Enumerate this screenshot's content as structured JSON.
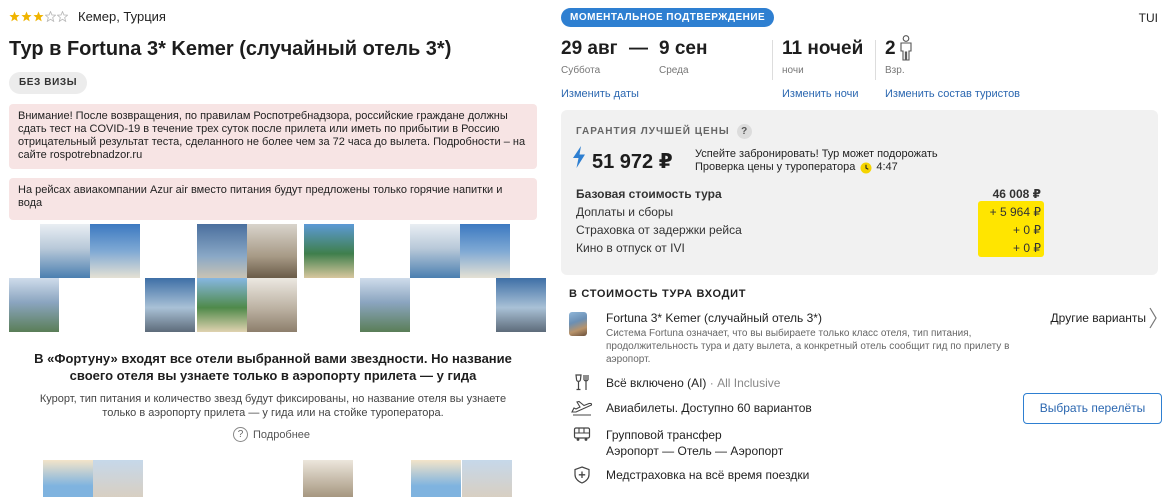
{
  "hotel": {
    "stars_filled": 3,
    "stars_total": 5,
    "location": "Кемер, Турция",
    "title_prefix": "Тур в ",
    "title_name": "Fortuna 3* Kemer (случайный отель 3*)",
    "visa_badge": "БЕЗ ВИЗЫ"
  },
  "warnings": [
    "Внимание! После возвращения, по правилам Роспотребнадзора, российские граждане должны сдать тест на COVID-19 в течение трех суток после прилета или иметь по прибытии в Россию отрицательный результат теста, сделанного не более чем за 72 часа до вылета. Подробности – на сайте rospotrebnadzor.ru",
    "На рейсах авиакомпании Azur air вместо питания будут предложены только горячие напитки и вода"
  ],
  "fortuna": {
    "heading": "В «Фортуну» входят все отели выбранной вами звездности. Но название своего отеля вы узнаете только в аэропорту прилета — у гида",
    "subtext": "Курорт, тип питания и количество звезд будут фиксированы, но название отеля вы узнаете только в аэропорту прилета — у гида или на стойке туроператора.",
    "more_link": "Подробнее"
  },
  "booking": {
    "instant_badge": "МОМЕНТАЛЬНОЕ ПОДТВЕРЖДЕНИЕ",
    "operator": "TUI",
    "date_from": "29 авг",
    "dash": "—",
    "date_to": "9 сен",
    "day_from": "Суббота",
    "day_to": "Среда",
    "nights": "11 ночей",
    "nights_sub": "ночи",
    "adults": "2",
    "adults_sub": "Взр.",
    "change_dates": "Изменить даты",
    "change_nights": "Изменить ночи",
    "change_tourists": "Изменить состав туристов"
  },
  "price": {
    "guarantee": "ГАРАНТИЯ ЛУЧШЕЙ ЦЕНЫ",
    "help": "?",
    "total": "51 972 ₽",
    "hurry_line1": "Успейте забронировать! Тур может подорожать",
    "hurry_line2": "Проверка цены у туроператора",
    "timer": "4:47",
    "base_label": "Базовая стоимость тура",
    "base_value": "46 008 ₽",
    "lines": [
      {
        "label": "Доплаты и сборы",
        "value": "+ 5 964 ₽"
      },
      {
        "label": "Страховка от задержки рейса",
        "value": "+ 0 ₽"
      },
      {
        "label": "Кино в отпуск от IVI",
        "value": "+ 0 ₽"
      }
    ],
    "highlight_color": "#ffe500"
  },
  "included": {
    "title": "В СТОИМОСТЬ ТУРА ВХОДИТ",
    "hotel_name": "Fortuna 3* Kemer (случайный отель 3*)",
    "hotel_desc": "Система Fortuna означает, что вы выбираете только класс отеля, тип питания, продолжительность тура и дату вылета, а конкретный отель сообщит гид по прилету в аэропорт.",
    "other_variants": "Другие варианты",
    "meal": "Всё включено (AI)",
    "meal_alt": " · All Inclusive",
    "flights": "Авиабилеты. Доступно 60 вариантов",
    "choose_flights": "Выбрать перелёты",
    "transfer_line1": "Групповой трансфер",
    "transfer_line2": "Аэропорт — Отель — Аэропорт",
    "insurance": "Медстраховка на всё время поездки"
  },
  "colors": {
    "accent": "#2e7fd1",
    "link": "#2b67b0",
    "warning_bg": "#f7e4e4",
    "star": "#f0b400"
  }
}
